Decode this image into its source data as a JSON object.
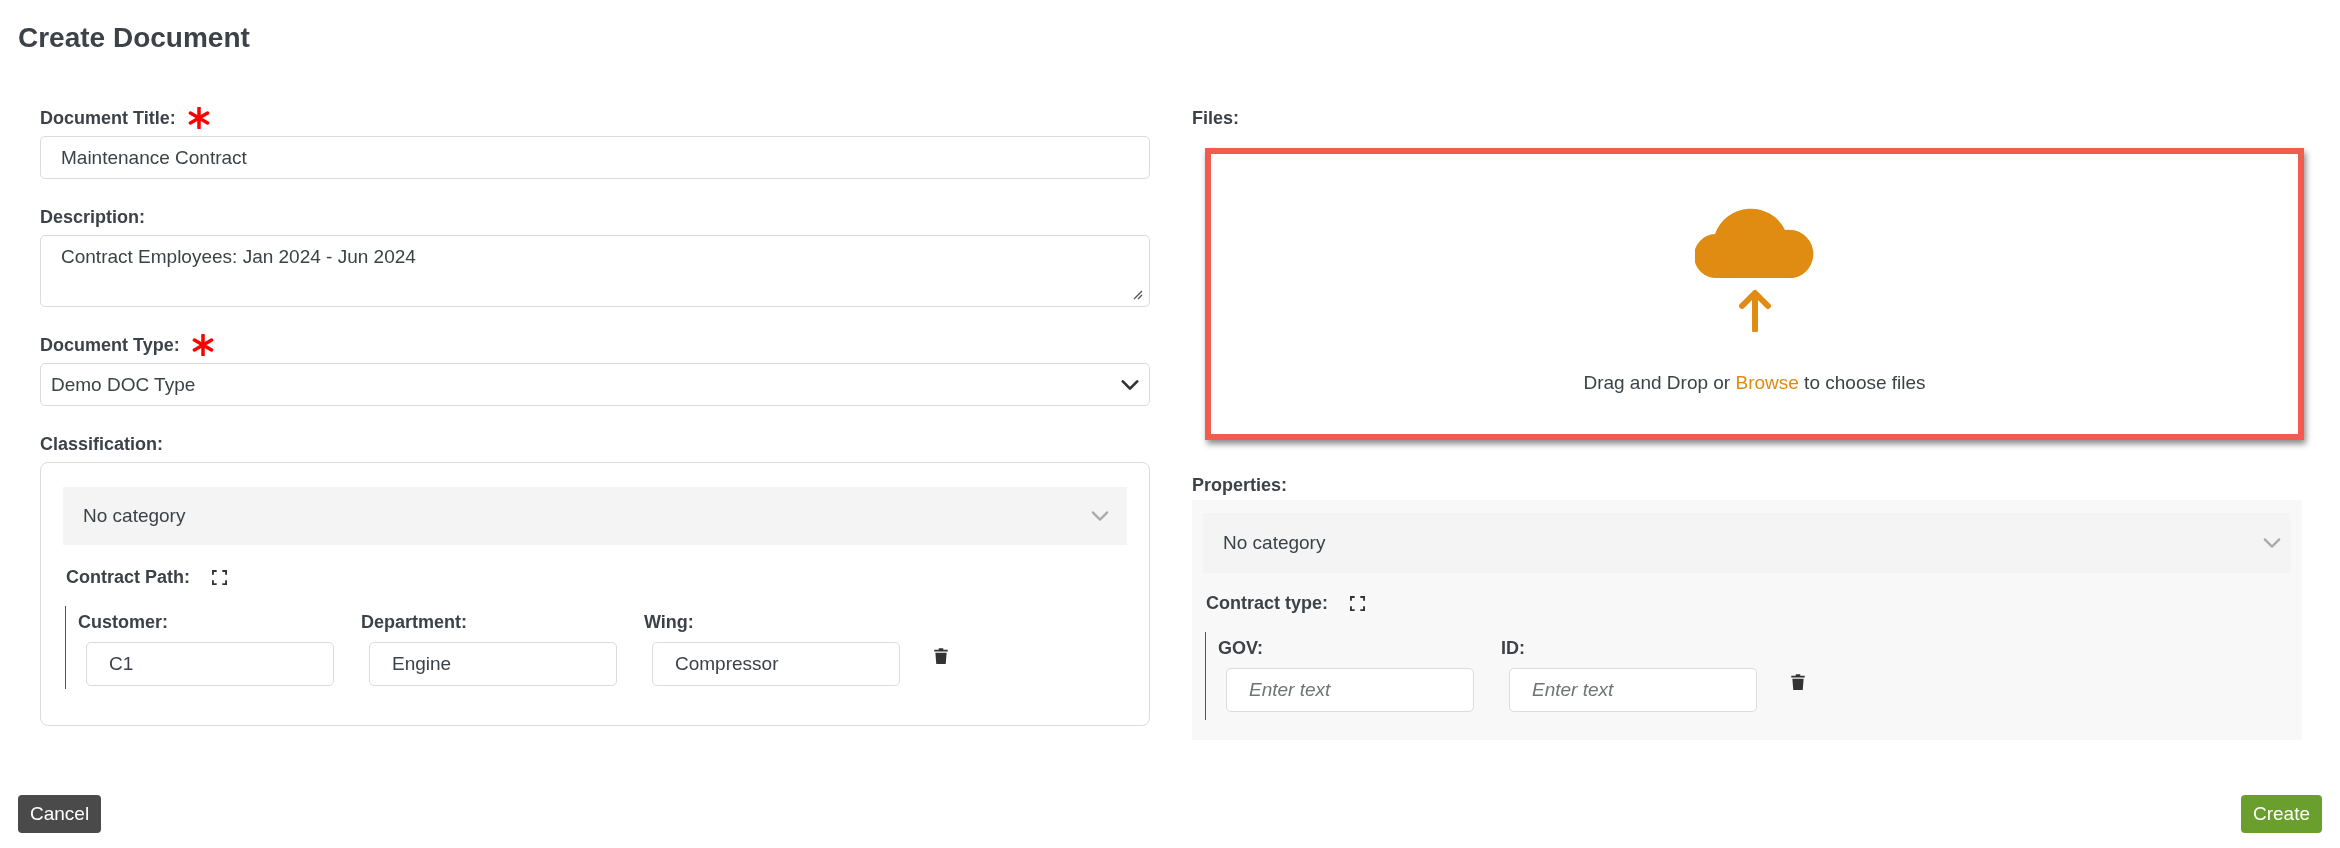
{
  "page": {
    "title": "Create Document"
  },
  "fields": [
    {
      "kind": "text",
      "label": "Document Title:",
      "required": true,
      "value": "Maintenance Contract"
    },
    {
      "kind": "textarea",
      "label": "Description:",
      "required": false,
      "value": "Contract Employees: Jan 2024 - Jun 2024"
    },
    {
      "kind": "select",
      "label": "Document Type:",
      "required": true,
      "value": "Demo DOC Type"
    }
  ],
  "classification": {
    "label": "Classification:",
    "category": "No category",
    "group": {
      "label": "Contract Path:",
      "fields": [
        {
          "label": "Customer:",
          "value": "C1"
        },
        {
          "label": "Department:",
          "value": "Engine"
        },
        {
          "label": "Wing:",
          "value": "Compressor"
        }
      ]
    }
  },
  "files": {
    "label": "Files:",
    "highlighted": true,
    "prompt_before": "Drag and Drop or",
    "link": "Browse",
    "prompt_after": "to choose files"
  },
  "properties": {
    "label": "Properties:",
    "category": "No category",
    "group": {
      "label": "Contract type:",
      "fields": [
        {
          "label": "GOV:",
          "placeholder": "Enter text"
        },
        {
          "label": "ID:",
          "placeholder": "Enter text"
        }
      ]
    }
  },
  "buttons": [
    {
      "kind": "cancel",
      "label": "Cancel"
    },
    {
      "kind": "create",
      "label": "Create"
    }
  ]
}
